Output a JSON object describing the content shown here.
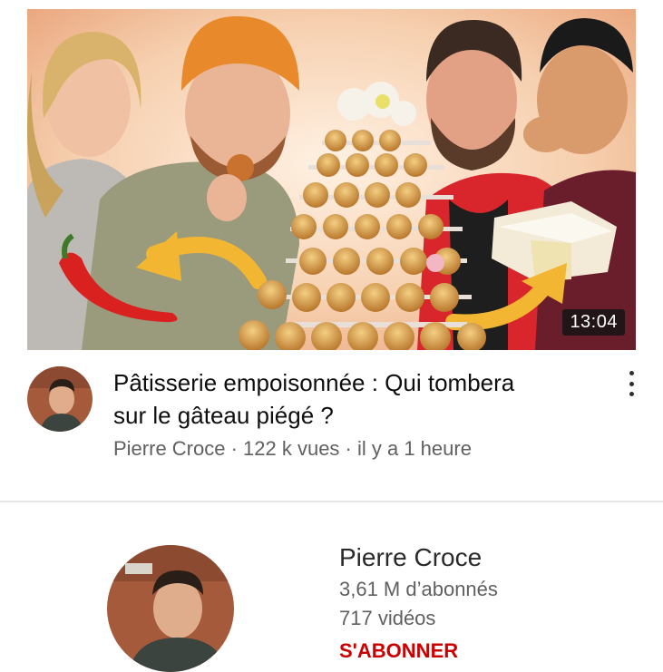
{
  "video": {
    "duration": "13:04",
    "title_line1": "Pâtisserie empoisonnée : Qui tombera",
    "title_line2": "sur le gâteau piégé ?",
    "meta": "Pierre Croce · 122 k vues · il y a 1 heure"
  },
  "channel": {
    "name": "Pierre Croce",
    "subscribers": "3,61 M d’abonnés",
    "videos": "717 vidéos",
    "subscribe_label": "S'ABONNER"
  },
  "colors": {
    "subscribe": "#cc0000",
    "meta_text": "#606060",
    "title_text": "#0f0f0f"
  }
}
